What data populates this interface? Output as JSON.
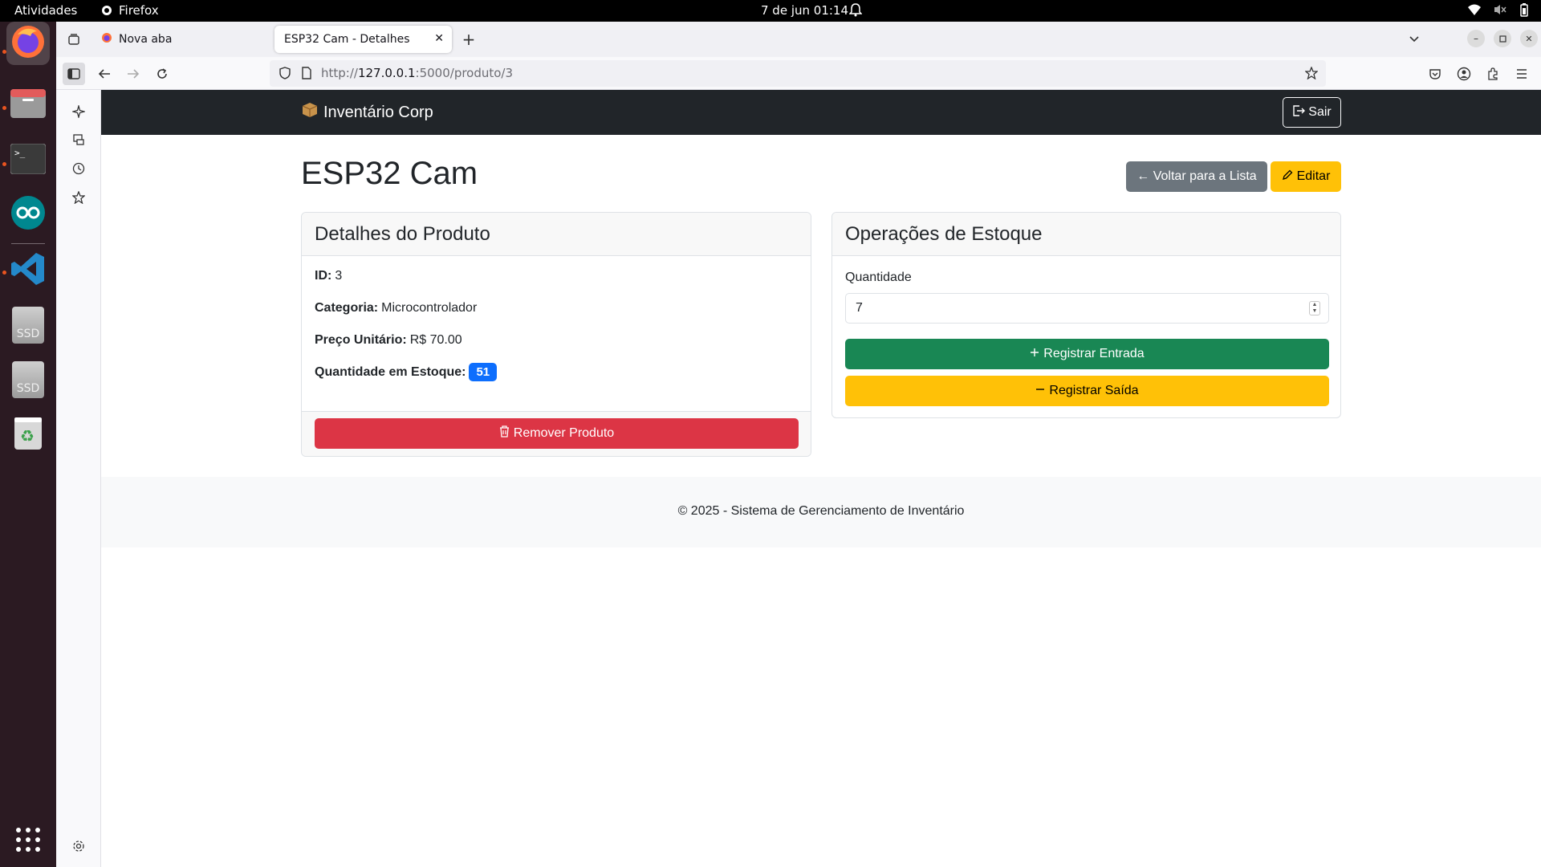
{
  "topbar": {
    "activities": "Atividades",
    "app_name": "Firefox",
    "clock": "7 de jun  01:14"
  },
  "dock": {
    "items": [
      "firefox-icon",
      "files-icon",
      "terminal-icon",
      "arduino-icon",
      "vscode-icon",
      "ssd-drive-icon",
      "ssd-drive-icon",
      "trash-icon",
      "show-apps-icon"
    ],
    "ssd_label": "SSD"
  },
  "browser": {
    "tabs": [
      {
        "title": "Nova aba",
        "active": false
      },
      {
        "title": "ESP32 Cam - Detalhes",
        "active": true
      }
    ],
    "url_prefix": "http://",
    "url_host": "127.0.0.1",
    "url_path": ":5000/produto/3"
  },
  "app": {
    "brand": "Inventário Corp",
    "logout": "Sair"
  },
  "product": {
    "name": "ESP32 Cam",
    "back_button": "← Voltar para a Lista",
    "edit_button": "Editar",
    "details_title": "Detalhes do Produto",
    "id_label": "ID:",
    "id_value": "3",
    "category_label": "Categoria:",
    "category_value": "Microcontrolador",
    "price_label": "Preço Unitário:",
    "price_value": "R$ 70.00",
    "stock_label": "Quantidade em Estoque:",
    "stock_value": "51",
    "remove_button": "Remover Produto"
  },
  "stock_ops": {
    "title": "Operações de Estoque",
    "quantity_label": "Quantidade",
    "quantity_value": "7",
    "entry_button": "Registrar Entrada",
    "exit_button": "Registrar Saída"
  },
  "footer": {
    "text": "© 2025 - Sistema de Gerenciamento de Inventário"
  },
  "colors": {
    "navbar": "#212529",
    "primary": "#0d6efd",
    "secondary": "#6c757d",
    "warning": "#ffc107",
    "danger": "#dc3545",
    "success": "#198754"
  }
}
